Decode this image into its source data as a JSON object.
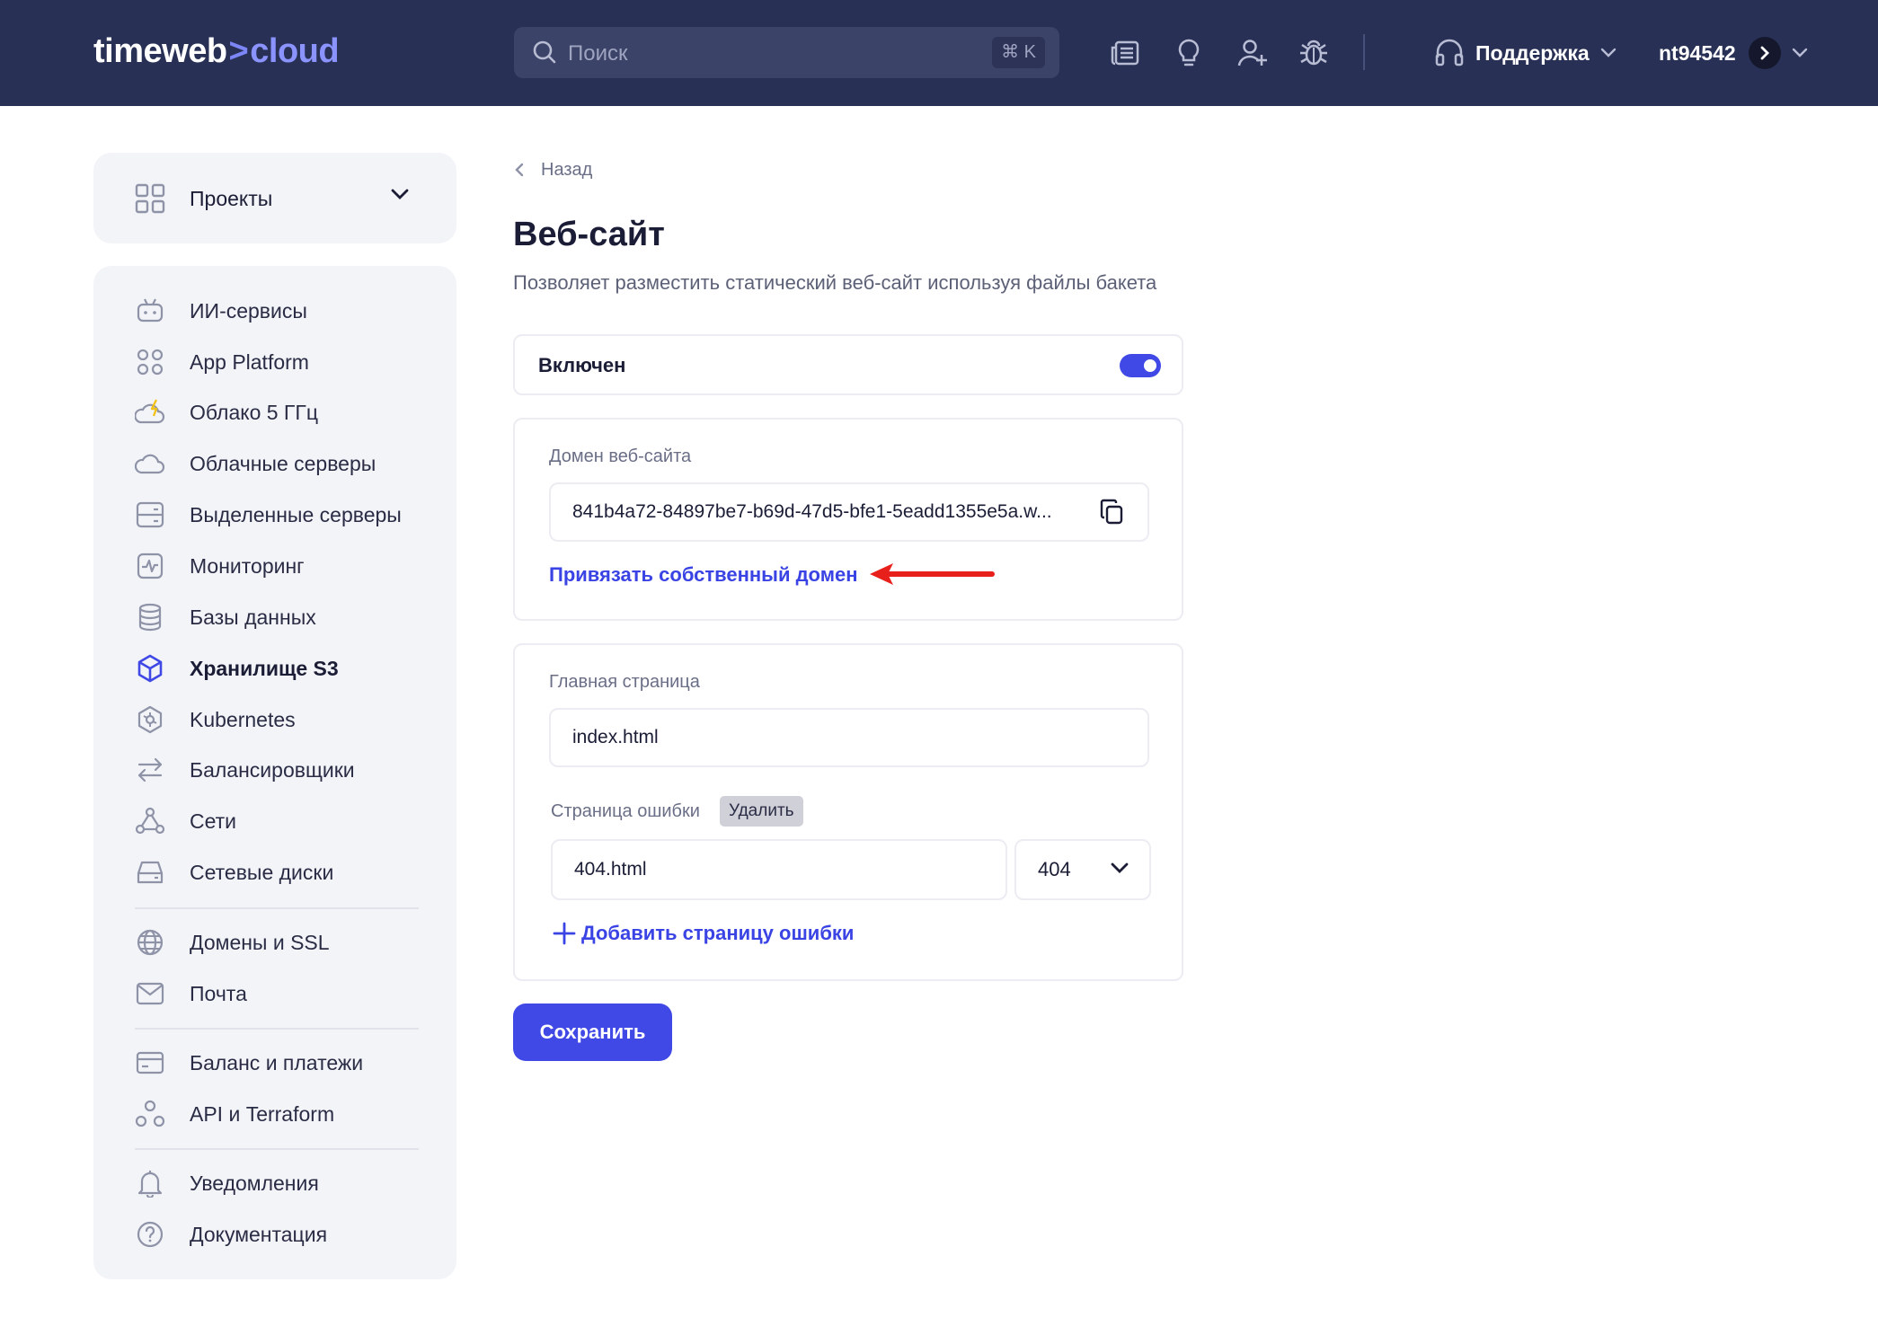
{
  "header": {
    "logo_main": "timeweb",
    "logo_sep": ">",
    "logo_accent": "cloud",
    "search_placeholder": "Поиск",
    "search_shortcut": "⌘ K",
    "support_label": "Поддержка",
    "username": "nt94542"
  },
  "sidebar": {
    "projects_label": "Проекты",
    "items": [
      {
        "label": "ИИ-сервисы",
        "icon": "robot-icon"
      },
      {
        "label": "App Platform",
        "icon": "apps-icon"
      },
      {
        "label": "Облако 5 ГГц",
        "icon": "cloud-bolt-icon"
      },
      {
        "label": "Облачные серверы",
        "icon": "cloud-icon"
      },
      {
        "label": "Выделенные серверы",
        "icon": "server-icon"
      },
      {
        "label": "Мониторинг",
        "icon": "monitoring-icon"
      },
      {
        "label": "Базы данных",
        "icon": "database-icon"
      },
      {
        "label": "Хранилище S3",
        "icon": "cube-icon"
      },
      {
        "label": "Kubernetes",
        "icon": "kubernetes-icon"
      },
      {
        "label": "Балансировщики",
        "icon": "balancer-icon"
      },
      {
        "label": "Сети",
        "icon": "network-icon"
      },
      {
        "label": "Сетевые диски",
        "icon": "disk-icon"
      },
      {
        "label": "Домены и SSL",
        "icon": "globe-icon"
      },
      {
        "label": "Почта",
        "icon": "mail-icon"
      },
      {
        "label": "Баланс и платежи",
        "icon": "card-icon"
      },
      {
        "label": "API и Terraform",
        "icon": "api-icon"
      },
      {
        "label": "Уведомления",
        "icon": "bell-icon"
      },
      {
        "label": "Документация",
        "icon": "help-icon"
      }
    ],
    "active_item": "Хранилище S3"
  },
  "main": {
    "back_label": "Назад",
    "title": "Веб-сайт",
    "subtitle": "Позволяет разместить статический веб-сайт используя файлы бакета",
    "enabled_label": "Включен",
    "enabled": true,
    "domain_label": "Домен веб-сайта",
    "domain_value": "841b4a72-84897be7-b69d-47d5-bfe1-5eadd1355e5a.w...",
    "bind_domain_link": "Привязать собственный домен",
    "index_label": "Главная страница",
    "index_value": "index.html",
    "error_label": "Страница ошибки",
    "error_delete": "Удалить",
    "error_value": "404.html",
    "error_code": "404",
    "add_error_link": "Добавить страницу ошибки",
    "save_label": "Сохранить"
  },
  "colors": {
    "header_bg": "#283056",
    "accent": "#4049e5",
    "sidebar_bg": "#f3f4f8",
    "annotation_arrow": "#e8201c"
  }
}
